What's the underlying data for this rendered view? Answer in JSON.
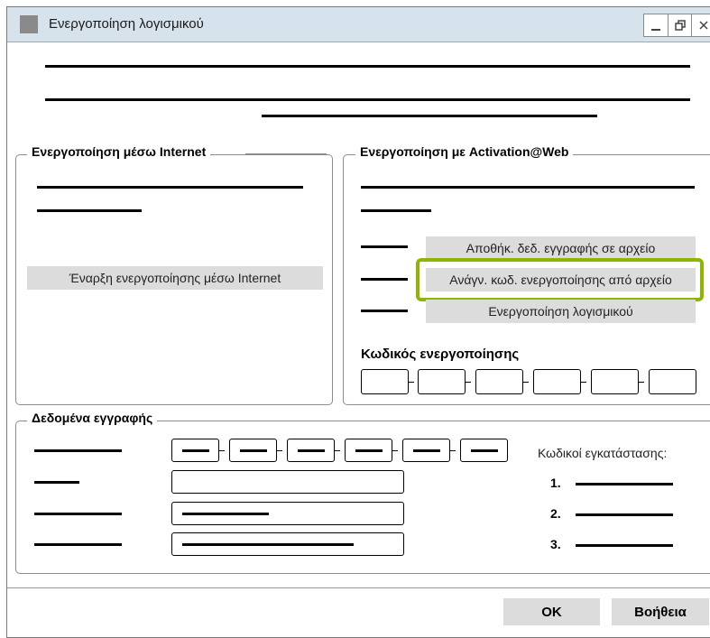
{
  "window": {
    "title": "Ενεργοποίηση λογισμικού",
    "controls": [
      "minimize-icon",
      "restore-icon",
      "close-icon"
    ]
  },
  "internet_group": {
    "legend": "Ενεργοποίηση μέσω Internet",
    "start_button": "Έναρξη ενεργοποίησης μέσω Internet"
  },
  "web_group": {
    "legend": "Ενεργοποίηση με Activation@Web",
    "save_button": "Αποθήκ. δεδ. εγγραφής σε αρχείο",
    "read_button": "Ανάγν. κωδ. ενεργοποίησης από αρχείο",
    "activate_button": "Ενεργοποίηση λογισμικού",
    "activation_code_label": "Κωδικός ενεργοποίησης"
  },
  "registration_group": {
    "legend": "Δεδομένα εγγραφής",
    "install_codes_label": "Κωδικοί εγκατάστασης:",
    "install_codes": [
      "1.",
      "2.",
      "3."
    ]
  },
  "footer": {
    "ok_button": "OK",
    "help_button": "Βοήθεια"
  },
  "colors": {
    "highlight": "#8db600",
    "titlebar": "#d7e3ec",
    "button": "#dcdcdc"
  }
}
